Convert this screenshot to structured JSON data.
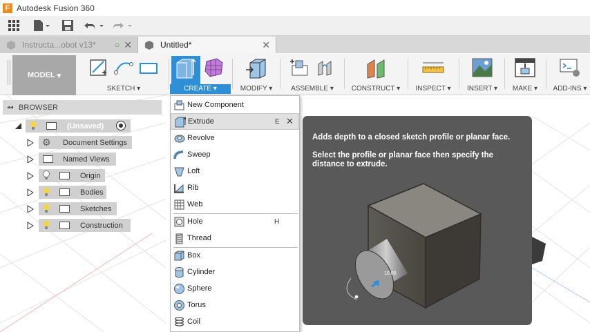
{
  "app": {
    "title": "Autodesk Fusion 360",
    "logo_letter": "F"
  },
  "tabs": [
    {
      "label": "Instructa...obot v13*",
      "active": false
    },
    {
      "label": "Untitled*",
      "active": true
    }
  ],
  "ribbon": {
    "workspace": "MODEL",
    "groups": {
      "sketch": "SKETCH",
      "create": "CREATE",
      "modify": "MODIFY",
      "assemble": "ASSEMBLE",
      "construct": "CONSTRUCT",
      "inspect": "INSPECT",
      "insert": "INSERT",
      "make": "MAKE",
      "addins": "ADD-INS"
    }
  },
  "browser": {
    "title": "BROWSER",
    "root": "(Unsaved)",
    "items": [
      "Document Settings",
      "Named Views",
      "Origin",
      "Bodies",
      "Sketches",
      "Construction"
    ]
  },
  "create_menu": {
    "items": [
      {
        "label": "New Component",
        "icon": "new-component-icon"
      },
      {
        "label": "Extrude",
        "icon": "extrude-icon",
        "shortcut": "E",
        "highlighted": true
      },
      {
        "label": "Revolve",
        "icon": "revolve-icon"
      },
      {
        "label": "Sweep",
        "icon": "sweep-icon"
      },
      {
        "label": "Loft",
        "icon": "loft-icon"
      },
      {
        "label": "Rib",
        "icon": "rib-icon"
      },
      {
        "label": "Web",
        "icon": "web-icon"
      },
      {
        "label": "Hole",
        "icon": "hole-icon",
        "shortcut": "H"
      },
      {
        "label": "Thread",
        "icon": "thread-icon"
      },
      {
        "label": "Box",
        "icon": "box-icon"
      },
      {
        "label": "Cylinder",
        "icon": "cylinder-icon"
      },
      {
        "label": "Sphere",
        "icon": "sphere-icon"
      },
      {
        "label": "Torus",
        "icon": "torus-icon"
      },
      {
        "label": "Coil",
        "icon": "coil-icon"
      }
    ]
  },
  "tooltip": {
    "line1": "Adds depth to a closed sketch profile or planar face.",
    "line2": "Select the profile or planar face then specify the distance to extrude.",
    "dimension": "10.00"
  },
  "colors": {
    "accent": "#2d8fd6",
    "ribbon_bg": "#f4f4f4",
    "tooltip_bg": "#595959",
    "workspace_bg": "#a8a8a8"
  }
}
